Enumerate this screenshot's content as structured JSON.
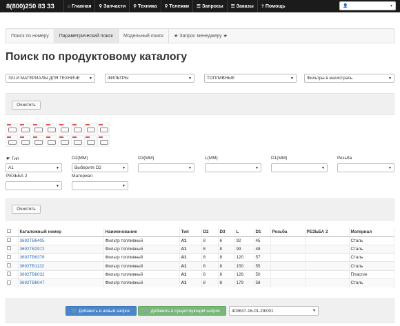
{
  "topbar": {
    "phone": "8(800)250 83 33",
    "nav": [
      {
        "icon": "home-icon",
        "glyph": "⌂",
        "label": "Главная"
      },
      {
        "icon": "search-icon",
        "glyph": "⚲",
        "label": "Запчасти"
      },
      {
        "icon": "search-icon",
        "glyph": "⚲",
        "label": "Техника"
      },
      {
        "icon": "search-icon",
        "glyph": "⚲",
        "label": "Тележки"
      },
      {
        "icon": "list-icon",
        "glyph": "☰",
        "label": "Запросы"
      },
      {
        "icon": "list-icon",
        "glyph": "☰",
        "label": "Заказы"
      },
      {
        "icon": "question-icon",
        "glyph": "?",
        "label": "Помощь"
      }
    ],
    "user_icon": "user-icon"
  },
  "tabs": [
    "Поиск по номеру",
    "Параметрический поиск",
    "Модельный поиск",
    "★ Запрос менеджеру ★"
  ],
  "title": "Поиск по продуктовому каталогу",
  "category_selects": [
    "З/Ч И МАТЕРИАЛЫ ДЛЯ ТЕХНИЧЕ",
    "ФИЛЬТРЫ",
    "ТОПЛИВНЫЕ",
    "Фильтры в магистраль"
  ],
  "clear_label": "Очистить",
  "filters": {
    "type_label": "Тип",
    "type_value": "A1",
    "d2_label": "D2(MM)",
    "d2_value": "Выберите D2",
    "d3_label": "D3(MM)",
    "l_label": "L(MM)",
    "d1_label": "D1(MM)",
    "thread_label": "Резьба",
    "thread2_label": "РЕЗЬБА 2",
    "material_label": "Материал"
  },
  "table": {
    "headers": [
      "Каталожный номер",
      "Наименование",
      "Тип",
      "D2",
      "D3",
      "L",
      "D1",
      "Резьба",
      "РЕЗЬБА 2",
      "Материал"
    ],
    "rows": [
      [
        "3692TB6405",
        "Фильтр топливный",
        "A1",
        "8",
        "6",
        "92",
        "45",
        "",
        "",
        "Сталь"
      ],
      [
        "3692TB2972",
        "Фильтр топливный",
        "A1",
        "8",
        "8",
        "99",
        "48",
        "",
        "",
        "Сталь"
      ],
      [
        "3692TB6376",
        "Фильтр топливный",
        "A1",
        "8",
        "8",
        "120",
        "57",
        "",
        "",
        "Сталь"
      ],
      [
        "3692TB1132",
        "Фильтр топливный",
        "A1",
        "8",
        "8",
        "150",
        "55",
        "",
        "",
        "Сталь"
      ],
      [
        "3692TB8032",
        "Фильтр топливный",
        "A1",
        "8",
        "8",
        "126",
        "50",
        "",
        "",
        "Пластик"
      ],
      [
        "3692TB8047",
        "Фильтр топливный",
        "A1",
        "8",
        "8",
        "179",
        "58",
        "",
        "",
        "Сталь"
      ]
    ]
  },
  "actions": {
    "add_new": "Добавить в новый запрос",
    "add_existing": "Добавить в существующий запрос",
    "request_select": "403637-16-01-29/001"
  },
  "colors": {
    "topbar": "#1b1b1b",
    "primary": "#4a86c9",
    "success": "#79b77a",
    "link": "#2a6eb7"
  }
}
